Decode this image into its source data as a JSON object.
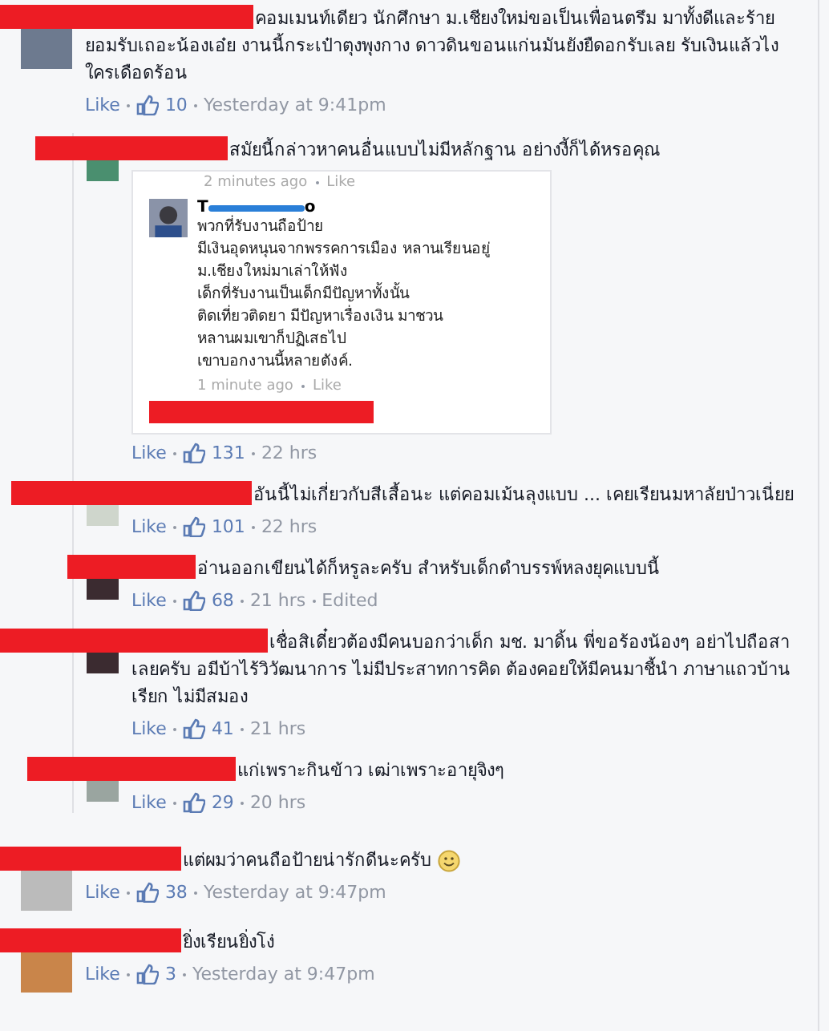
{
  "comment": {
    "text": "คอมเมนท์เดียว นักศึกษา ม.เชียงใหม่ขอเป็นเพื่อนตรึม มาทั้งดีและร้าย ยอมรับเถอะน้องเอ๋ย งานนี้กระเป๋าตุงพุงกาง ดาวดินขอนแก่นมันยังยืดอกรับเลย รับเงินแล้วไงใครเดือดร้อน",
    "like": "Like",
    "likes": "10",
    "meta": [
      "Yesterday at 9:41pm"
    ]
  },
  "replies": [
    {
      "text": "สมัยนี้กล่าวหาคนอื่นแบบไม่มีหลักฐาน อย่างงี้ก็ได้หรอคุณ",
      "like": "Like",
      "likes": "131",
      "meta": [
        "22 hrs"
      ],
      "attachment": {
        "top_meta": "2 minutes ago",
        "top_like": "Like",
        "name_start": "T",
        "name_end": "o",
        "lines": [
          "พวกที่รับงานถือป้าย",
          "มีเงินอุดหนุนจากพรรคการเมือง หลานเรียนอยู่",
          "ม.เชียงใหม่มาเล่าให้ฟัง",
          "เด็กที่รับงานเป็นเด็กมีปัญหาทั้งนั้น",
          "ติดเที่ยวติดยา  มีปัญหาเรื่องเงิน มาชวน",
          "หลานผมเขาก็ปฏิเสธไป",
          "เขาบอกงานนี้หลายตังค์."
        ],
        "time": "1 minute ago",
        "like": "Like"
      }
    },
    {
      "text": "อันนี้ไม่เกี่ยวกับสีเสื้อนะ แต่คอมเม้นลุงแบบ ... เคยเรียนมหาลัยป่าวเนี่ยย",
      "like": "Like",
      "likes": "101",
      "meta": [
        "22 hrs"
      ]
    },
    {
      "text": "อ่านออกเขียนได้ก็หรูละครับ สำหรับเด็กดำบรรพ์หลงยุคแบบนี้",
      "like": "Like",
      "likes": "68",
      "meta": [
        "21 hrs",
        "Edited"
      ]
    },
    {
      "text": "เชื่อสิเดี๋ยวต้องมีคนบอกว่าเด็ก มช. มาดิ้น พี่ขอร้องน้องๆ อย่าไปถือสาเลยครับ อมีบ้าไร้วิวัฒนาการ ไม่มีประสาทการคิด ต้องคอยให้มีคนมาชี้นำ ภาษาแถวบ้านเรียก ไม่มีสมอง",
      "like": "Like",
      "likes": "41",
      "meta": [
        "21 hrs"
      ]
    },
    {
      "text": "แก่เพราะกินข้าว เฒ่าเพราะอายุจิงๆ",
      "like": "Like",
      "likes": "29",
      "meta": [
        "20 hrs"
      ]
    }
  ],
  "comments": [
    {
      "text": "แต่ผมว่าคนถือป้ายน่ารักดีนะครับ",
      "smiley": true,
      "like": "Like",
      "likes": "38",
      "meta": [
        "Yesterday at 9:47pm"
      ]
    },
    {
      "text": "ยิ่งเรียนยิ่งโง่",
      "smiley": false,
      "like": "Like",
      "likes": "3",
      "meta": [
        "Yesterday at 9:47pm"
      ]
    }
  ]
}
